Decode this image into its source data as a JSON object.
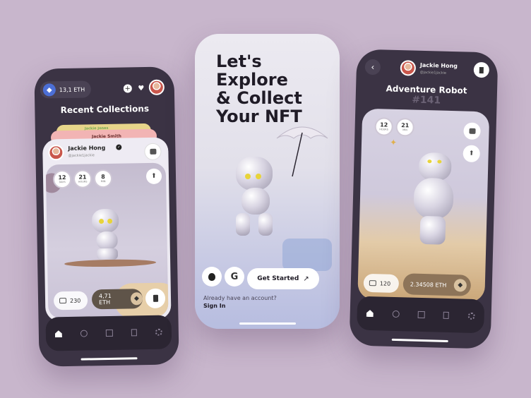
{
  "left": {
    "balance": "13,1 ETH",
    "section_title": "Recent Collections",
    "behind_card_1": "Jackie Jones",
    "behind_card_2": "Jackie Smith",
    "card": {
      "name": "Jackie Hong",
      "handle": "@jackie1jackie",
      "stats": [
        {
          "value": "12",
          "unit": "DAYS"
        },
        {
          "value": "21",
          "unit": "HOURS"
        },
        {
          "value": "8",
          "unit": "MIN"
        }
      ],
      "likes": "230",
      "price": "4,71 ETH"
    }
  },
  "middle": {
    "headline_1": "Let's",
    "headline_2": "Explore",
    "headline_3": "& Collect",
    "headline_4": "Your NFT",
    "cta": "Get Started",
    "account_prompt": "Already have an account?",
    "sign_in": "Sign In"
  },
  "right": {
    "user_name": "Jackie Hong",
    "user_handle": "@jackie1jackie",
    "title": "Adventure Robot",
    "number": "#141",
    "stats": [
      {
        "value": "12",
        "unit": "HOURS"
      },
      {
        "value": "21",
        "unit": "MIN"
      }
    ],
    "likes": "120",
    "price": "2.34508 ETH"
  },
  "colors": {
    "background": "#c8b6cc",
    "dark_phone": "#3b3344",
    "accent_yellow": "#e8d43a",
    "eth_blue": "#4c6fd6"
  }
}
